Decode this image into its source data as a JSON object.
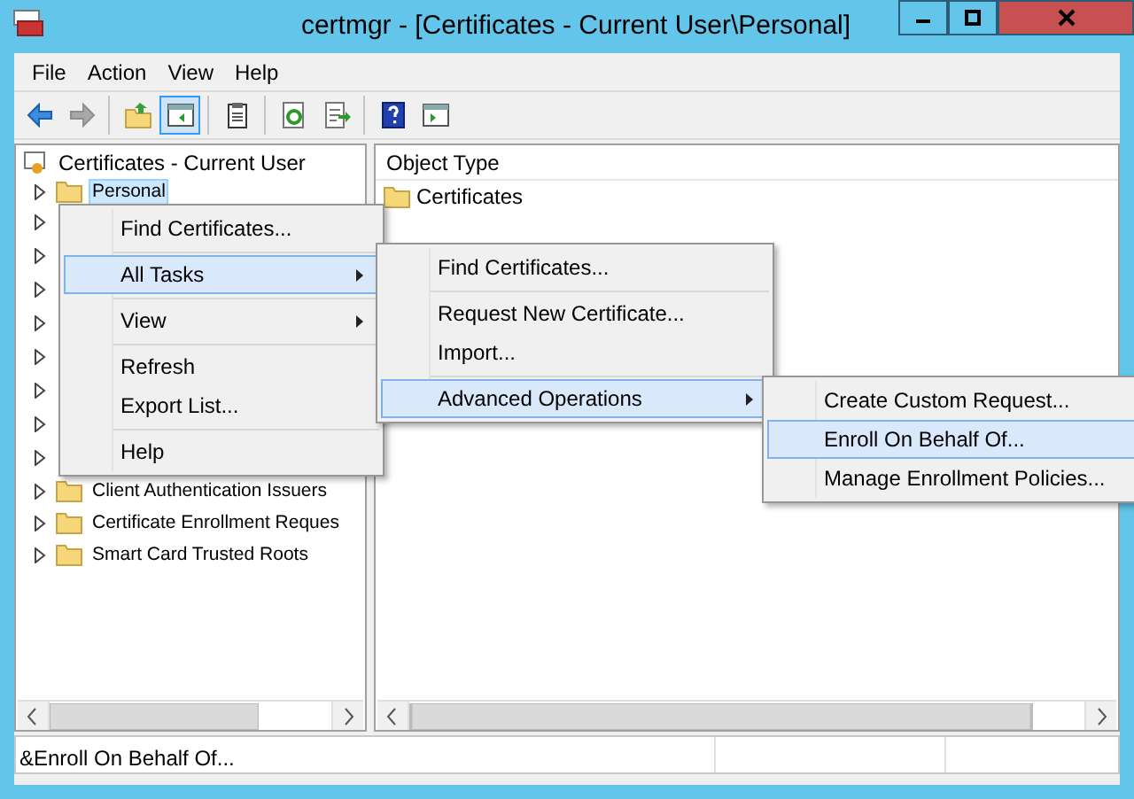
{
  "window": {
    "title": "certmgr - [Certificates - Current User\\Personal]"
  },
  "menu_bar": [
    "File",
    "Action",
    "View",
    "Help"
  ],
  "toolbar": [
    {
      "kind": "back",
      "disabled": false,
      "pressed": false
    },
    {
      "kind": "forward",
      "disabled": true,
      "pressed": false
    },
    {
      "kind": "separator"
    },
    {
      "kind": "up",
      "disabled": false,
      "pressed": false
    },
    {
      "kind": "tree",
      "disabled": false,
      "pressed": true
    },
    {
      "kind": "separator"
    },
    {
      "kind": "properties",
      "disabled": false,
      "pressed": false
    },
    {
      "kind": "separator"
    },
    {
      "kind": "refresh",
      "disabled": false,
      "pressed": false
    },
    {
      "kind": "export",
      "disabled": false,
      "pressed": false
    },
    {
      "kind": "separator"
    },
    {
      "kind": "help",
      "disabled": false,
      "pressed": false
    },
    {
      "kind": "actionpane",
      "disabled": false,
      "pressed": false
    }
  ],
  "tree": {
    "root": "Certificates - Current User",
    "items": [
      {
        "kind": "folder",
        "label": "Personal",
        "selected": true
      },
      {
        "kind": "covered"
      },
      {
        "kind": "covered"
      },
      {
        "kind": "covered"
      },
      {
        "kind": "covered"
      },
      {
        "kind": "covered"
      },
      {
        "kind": "covered"
      },
      {
        "kind": "covered"
      },
      {
        "kind": "covered"
      },
      {
        "kind": "folder",
        "label": "Client Authentication Issuers",
        "selected": false
      },
      {
        "kind": "folder",
        "label": "Certificate Enrollment Reques",
        "selected": false
      },
      {
        "kind": "folder",
        "label": "Smart Card Trusted Roots",
        "selected": false
      }
    ]
  },
  "list": {
    "columns": [
      "Object Type"
    ],
    "rows": [
      "Certificates"
    ]
  },
  "context_menus": [
    {
      "items": [
        {
          "kind": "item",
          "label": "Find Certificates...",
          "submenu": false,
          "selected": false
        },
        {
          "kind": "separator"
        },
        {
          "kind": "item",
          "label": "All Tasks",
          "submenu": true,
          "selected": true
        },
        {
          "kind": "separator"
        },
        {
          "kind": "item",
          "label": "View",
          "submenu": true,
          "selected": false
        },
        {
          "kind": "separator"
        },
        {
          "kind": "item",
          "label": "Refresh",
          "submenu": false,
          "selected": false
        },
        {
          "kind": "item",
          "label": "Export List...",
          "submenu": false,
          "selected": false
        },
        {
          "kind": "separator"
        },
        {
          "kind": "item",
          "label": "Help",
          "submenu": false,
          "selected": false
        }
      ]
    },
    {
      "items": [
        {
          "kind": "item",
          "label": "Find Certificates...",
          "submenu": false,
          "selected": false
        },
        {
          "kind": "separator"
        },
        {
          "kind": "item",
          "label": "Request New Certificate...",
          "submenu": false,
          "selected": false
        },
        {
          "kind": "item",
          "label": "Import...",
          "submenu": false,
          "selected": false
        },
        {
          "kind": "separator"
        },
        {
          "kind": "item",
          "label": "Advanced Operations",
          "submenu": true,
          "selected": true
        }
      ]
    },
    {
      "items": [
        {
          "kind": "item",
          "label": "Create Custom Request...",
          "submenu": false,
          "selected": false
        },
        {
          "kind": "item",
          "label": "Enroll On Behalf Of...",
          "submenu": false,
          "selected": true
        },
        {
          "kind": "item",
          "label": "Manage Enrollment Policies...",
          "submenu": false,
          "selected": false
        }
      ]
    }
  ],
  "status_bar": "&Enroll On Behalf Of..."
}
